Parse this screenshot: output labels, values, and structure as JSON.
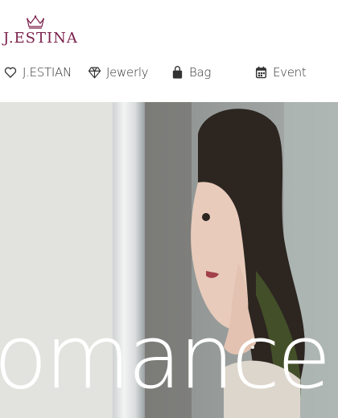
{
  "brand": {
    "logo_text": "J.ESTINA",
    "logo_icon": "crown-icon"
  },
  "nav": [
    {
      "label": "J.ESTIAN",
      "icon": "heart-icon"
    },
    {
      "label": "Jewerly",
      "icon": "diamond-icon"
    },
    {
      "label": "Bag",
      "icon": "bag-icon"
    },
    {
      "label": "Event",
      "icon": "calendar-icon"
    }
  ],
  "banner": {
    "word": "omance"
  },
  "colors": {
    "brand": "#7a1f4a",
    "nav_text": "#333333",
    "header_bg": "#ffffff"
  }
}
